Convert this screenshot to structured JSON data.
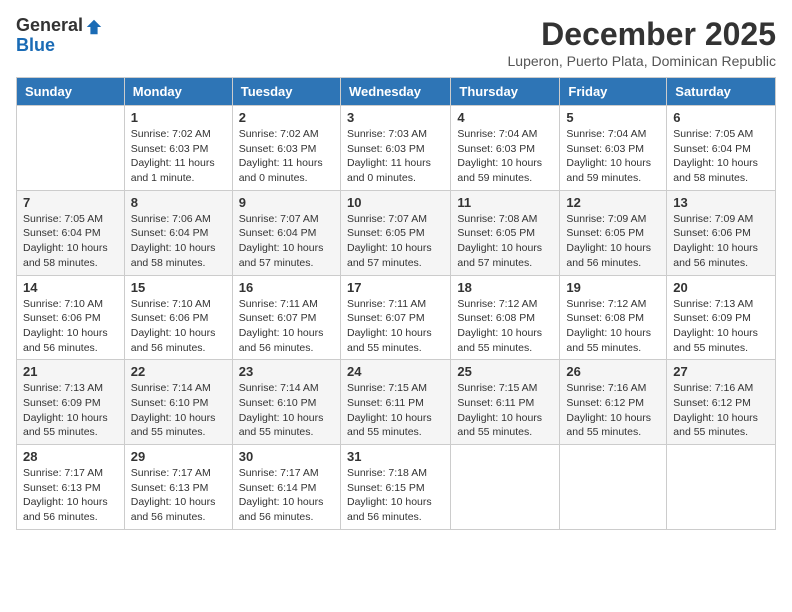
{
  "header": {
    "logo": {
      "general": "General",
      "blue": "Blue"
    },
    "title": "December 2025",
    "location": "Luperon, Puerto Plata, Dominican Republic"
  },
  "weekdays": [
    "Sunday",
    "Monday",
    "Tuesday",
    "Wednesday",
    "Thursday",
    "Friday",
    "Saturday"
  ],
  "weeks": [
    [
      {
        "day": "",
        "sunrise": "",
        "sunset": "",
        "daylight": ""
      },
      {
        "day": "1",
        "sunrise": "Sunrise: 7:02 AM",
        "sunset": "Sunset: 6:03 PM",
        "daylight": "Daylight: 11 hours and 1 minute."
      },
      {
        "day": "2",
        "sunrise": "Sunrise: 7:02 AM",
        "sunset": "Sunset: 6:03 PM",
        "daylight": "Daylight: 11 hours and 0 minutes."
      },
      {
        "day": "3",
        "sunrise": "Sunrise: 7:03 AM",
        "sunset": "Sunset: 6:03 PM",
        "daylight": "Daylight: 11 hours and 0 minutes."
      },
      {
        "day": "4",
        "sunrise": "Sunrise: 7:04 AM",
        "sunset": "Sunset: 6:03 PM",
        "daylight": "Daylight: 10 hours and 59 minutes."
      },
      {
        "day": "5",
        "sunrise": "Sunrise: 7:04 AM",
        "sunset": "Sunset: 6:03 PM",
        "daylight": "Daylight: 10 hours and 59 minutes."
      },
      {
        "day": "6",
        "sunrise": "Sunrise: 7:05 AM",
        "sunset": "Sunset: 6:04 PM",
        "daylight": "Daylight: 10 hours and 58 minutes."
      }
    ],
    [
      {
        "day": "7",
        "sunrise": "Sunrise: 7:05 AM",
        "sunset": "Sunset: 6:04 PM",
        "daylight": "Daylight: 10 hours and 58 minutes."
      },
      {
        "day": "8",
        "sunrise": "Sunrise: 7:06 AM",
        "sunset": "Sunset: 6:04 PM",
        "daylight": "Daylight: 10 hours and 58 minutes."
      },
      {
        "day": "9",
        "sunrise": "Sunrise: 7:07 AM",
        "sunset": "Sunset: 6:04 PM",
        "daylight": "Daylight: 10 hours and 57 minutes."
      },
      {
        "day": "10",
        "sunrise": "Sunrise: 7:07 AM",
        "sunset": "Sunset: 6:05 PM",
        "daylight": "Daylight: 10 hours and 57 minutes."
      },
      {
        "day": "11",
        "sunrise": "Sunrise: 7:08 AM",
        "sunset": "Sunset: 6:05 PM",
        "daylight": "Daylight: 10 hours and 57 minutes."
      },
      {
        "day": "12",
        "sunrise": "Sunrise: 7:09 AM",
        "sunset": "Sunset: 6:05 PM",
        "daylight": "Daylight: 10 hours and 56 minutes."
      },
      {
        "day": "13",
        "sunrise": "Sunrise: 7:09 AM",
        "sunset": "Sunset: 6:06 PM",
        "daylight": "Daylight: 10 hours and 56 minutes."
      }
    ],
    [
      {
        "day": "14",
        "sunrise": "Sunrise: 7:10 AM",
        "sunset": "Sunset: 6:06 PM",
        "daylight": "Daylight: 10 hours and 56 minutes."
      },
      {
        "day": "15",
        "sunrise": "Sunrise: 7:10 AM",
        "sunset": "Sunset: 6:06 PM",
        "daylight": "Daylight: 10 hours and 56 minutes."
      },
      {
        "day": "16",
        "sunrise": "Sunrise: 7:11 AM",
        "sunset": "Sunset: 6:07 PM",
        "daylight": "Daylight: 10 hours and 56 minutes."
      },
      {
        "day": "17",
        "sunrise": "Sunrise: 7:11 AM",
        "sunset": "Sunset: 6:07 PM",
        "daylight": "Daylight: 10 hours and 55 minutes."
      },
      {
        "day": "18",
        "sunrise": "Sunrise: 7:12 AM",
        "sunset": "Sunset: 6:08 PM",
        "daylight": "Daylight: 10 hours and 55 minutes."
      },
      {
        "day": "19",
        "sunrise": "Sunrise: 7:12 AM",
        "sunset": "Sunset: 6:08 PM",
        "daylight": "Daylight: 10 hours and 55 minutes."
      },
      {
        "day": "20",
        "sunrise": "Sunrise: 7:13 AM",
        "sunset": "Sunset: 6:09 PM",
        "daylight": "Daylight: 10 hours and 55 minutes."
      }
    ],
    [
      {
        "day": "21",
        "sunrise": "Sunrise: 7:13 AM",
        "sunset": "Sunset: 6:09 PM",
        "daylight": "Daylight: 10 hours and 55 minutes."
      },
      {
        "day": "22",
        "sunrise": "Sunrise: 7:14 AM",
        "sunset": "Sunset: 6:10 PM",
        "daylight": "Daylight: 10 hours and 55 minutes."
      },
      {
        "day": "23",
        "sunrise": "Sunrise: 7:14 AM",
        "sunset": "Sunset: 6:10 PM",
        "daylight": "Daylight: 10 hours and 55 minutes."
      },
      {
        "day": "24",
        "sunrise": "Sunrise: 7:15 AM",
        "sunset": "Sunset: 6:11 PM",
        "daylight": "Daylight: 10 hours and 55 minutes."
      },
      {
        "day": "25",
        "sunrise": "Sunrise: 7:15 AM",
        "sunset": "Sunset: 6:11 PM",
        "daylight": "Daylight: 10 hours and 55 minutes."
      },
      {
        "day": "26",
        "sunrise": "Sunrise: 7:16 AM",
        "sunset": "Sunset: 6:12 PM",
        "daylight": "Daylight: 10 hours and 55 minutes."
      },
      {
        "day": "27",
        "sunrise": "Sunrise: 7:16 AM",
        "sunset": "Sunset: 6:12 PM",
        "daylight": "Daylight: 10 hours and 55 minutes."
      }
    ],
    [
      {
        "day": "28",
        "sunrise": "Sunrise: 7:17 AM",
        "sunset": "Sunset: 6:13 PM",
        "daylight": "Daylight: 10 hours and 56 minutes."
      },
      {
        "day": "29",
        "sunrise": "Sunrise: 7:17 AM",
        "sunset": "Sunset: 6:13 PM",
        "daylight": "Daylight: 10 hours and 56 minutes."
      },
      {
        "day": "30",
        "sunrise": "Sunrise: 7:17 AM",
        "sunset": "Sunset: 6:14 PM",
        "daylight": "Daylight: 10 hours and 56 minutes."
      },
      {
        "day": "31",
        "sunrise": "Sunrise: 7:18 AM",
        "sunset": "Sunset: 6:15 PM",
        "daylight": "Daylight: 10 hours and 56 minutes."
      },
      {
        "day": "",
        "sunrise": "",
        "sunset": "",
        "daylight": ""
      },
      {
        "day": "",
        "sunrise": "",
        "sunset": "",
        "daylight": ""
      },
      {
        "day": "",
        "sunrise": "",
        "sunset": "",
        "daylight": ""
      }
    ]
  ]
}
